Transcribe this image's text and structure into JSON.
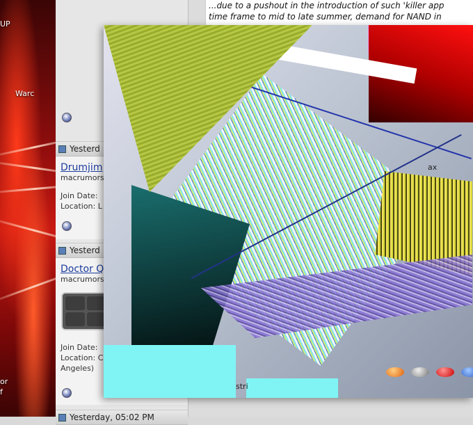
{
  "desktop": {
    "labels": [
      "UP",
      "Warc",
      "or",
      "f"
    ]
  },
  "forum": {
    "quote_lines": [
      "...due to a pushout in the introduction of such 'killer app",
      "time frame to mid to late summer, demand for NAND in"
    ],
    "posts": [
      {
        "header": "Yesterd",
        "username": "Drumjim",
        "user_title": "macrumors",
        "join_date_label": "Join Date:",
        "location_label": "Location: L"
      },
      {
        "header": "Yesterd",
        "username": "Doctor Q",
        "user_title": "macrumors",
        "join_date_label": "Join Date:",
        "location_label": "Location: C",
        "location_cont": "Angeles)"
      }
    ],
    "footer_header": "Yesterday, 05:02 PM"
  },
  "glitch_window": {
    "labels": [
      "ax",
      "stri"
    ]
  },
  "colors": {
    "desktop_red": "#c81a12",
    "link_blue": "#1c3c9e",
    "glitch_cyan": "#80f4f4"
  }
}
